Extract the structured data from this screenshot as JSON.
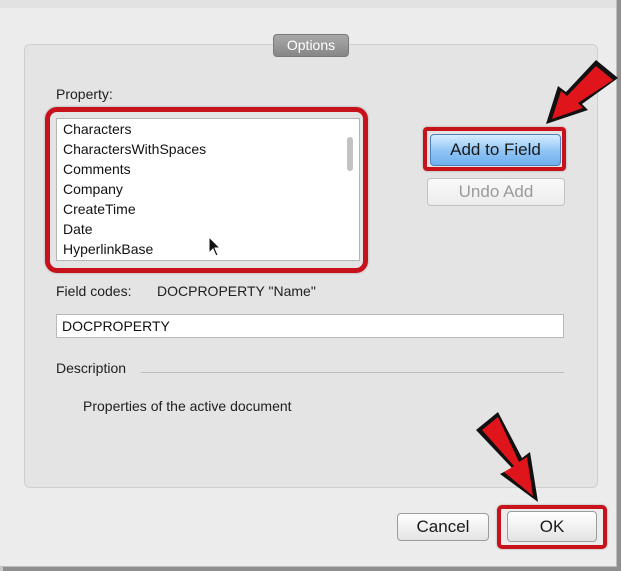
{
  "dialog": {
    "group_title": "Options",
    "property_label": "Property:",
    "properties": [
      "Characters",
      "CharactersWithSpaces",
      "Comments",
      "Company",
      "CreateTime",
      "Date",
      "HyperlinkBase"
    ],
    "add_button": "Add to Field",
    "undo_button": "Undo Add",
    "field_codes_label": "Field codes:",
    "field_codes_value": "DOCPROPERTY \"Name\"",
    "field_input_value": "DOCPROPERTY",
    "description_label": "Description",
    "description_text": "Properties of the active document",
    "cancel_button": "Cancel",
    "ok_button": "OK"
  },
  "colors": {
    "annotation_red": "#c8121b",
    "primary_button_blue": "#8ec4f4"
  }
}
